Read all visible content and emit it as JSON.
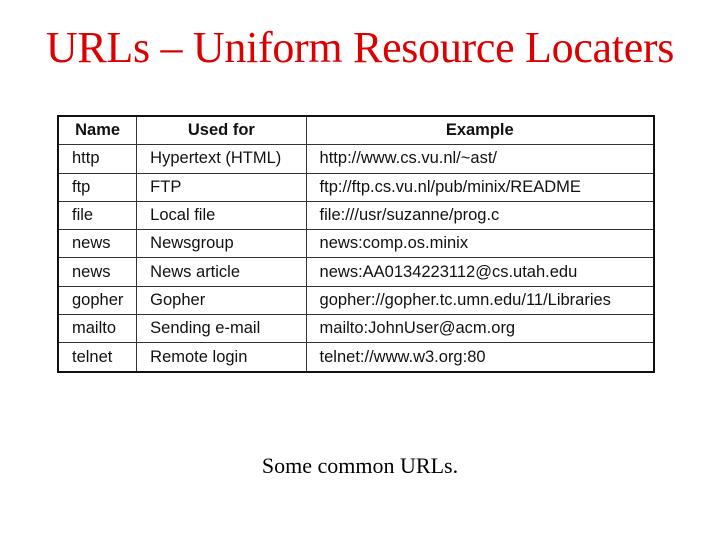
{
  "title": "URLs – Uniform Resource Locaters",
  "table": {
    "headers": [
      "Name",
      "Used for",
      "Example"
    ],
    "rows": [
      [
        "http",
        "Hypertext (HTML)",
        "http://www.cs.vu.nl/~ast/"
      ],
      [
        "ftp",
        "FTP",
        "ftp://ftp.cs.vu.nl/pub/minix/README"
      ],
      [
        "file",
        "Local file",
        "file:///usr/suzanne/prog.c"
      ],
      [
        "news",
        "Newsgroup",
        "news:comp.os.minix"
      ],
      [
        "news",
        "News article",
        "news:AA0134223112@cs.utah.edu"
      ],
      [
        "gopher",
        "Gopher",
        "gopher://gopher.tc.umn.edu/11/Libraries"
      ],
      [
        "mailto",
        "Sending e-mail",
        "mailto:JohnUser@acm.org"
      ],
      [
        "telnet",
        "Remote login",
        "telnet://www.w3.org:80"
      ]
    ]
  },
  "caption": "Some common URLs.",
  "colors": {
    "title": "#dd0000"
  }
}
